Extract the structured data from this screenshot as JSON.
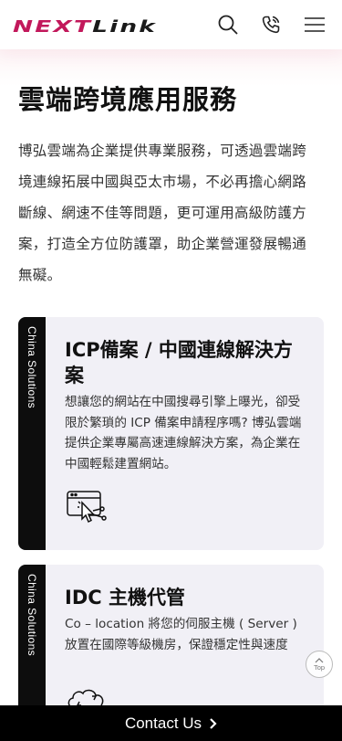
{
  "header": {
    "logo_text": "NEXTLink",
    "brand_color": "#c2185b",
    "icons": [
      "search-icon",
      "phone-icon",
      "menu-icon"
    ]
  },
  "page": {
    "title": "雲端跨境應用服務",
    "intro": "博弘雲端為企業提供專業服務，可透過雲端跨境連線拓展中國與亞太市場，不必再擔心網路斷線、網速不佳等問題，更可運用高級防護方案，打造全方位防護罩，助企業營運發展暢通無礙。"
  },
  "cards": [
    {
      "stripe_label": "China Solutions",
      "title": "ICP備案 / 中國連線解決方案",
      "description": "想讓您的網站在中國搜尋引擎上曝光，卻受限於繁瑣的 ICP 備案申請程序嗎? 博弘雲端提供企業專屬高速連線解決方案，為企業在中國輕鬆建置網站。",
      "icon": "web-click-icon"
    },
    {
      "stripe_label": "China Solutions",
      "title": "IDC 主機代管",
      "description": "Co – location 將您的伺服主機 ( Server ) 放置在國際等級機房，保證穩定性與速度",
      "icon": "cloud-sync-icon"
    }
  ],
  "back_to_top": {
    "label": "Top"
  },
  "contact_bar": {
    "label": "Contact Us"
  }
}
